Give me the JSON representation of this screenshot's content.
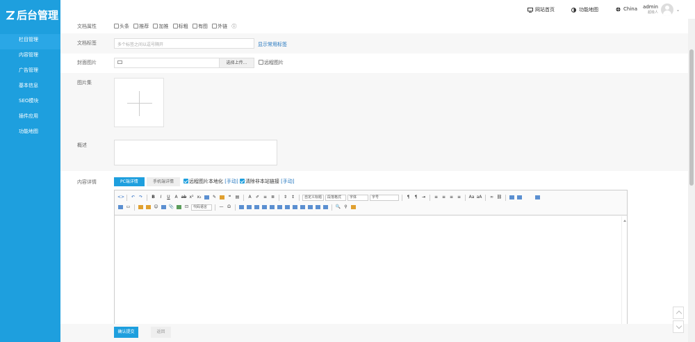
{
  "app": {
    "brand": "后台管理"
  },
  "sidebar": {
    "items": [
      {
        "label": "栏目管理"
      },
      {
        "label": "内容管理"
      },
      {
        "label": "广告管理"
      },
      {
        "label": "基本信息"
      },
      {
        "label": "SEO模块"
      },
      {
        "label": "插件应用"
      },
      {
        "label": "功能地图"
      }
    ]
  },
  "topbar": {
    "site_home": "网站首页",
    "func_map": "功能地图",
    "language": "China",
    "username": "admin",
    "role": "超级人"
  },
  "form": {
    "attr_label": "文档属性",
    "attrs": [
      "头条",
      "推荐",
      "加推",
      "标粗",
      "有图",
      "外链"
    ],
    "tags_label": "文档标签",
    "tags_placeholder": "多个标签之间以逗号隔开",
    "tags_link": "显示常用标签",
    "cover_label": "封面图片",
    "upload_btn": "选择上传...",
    "remote_image": "远程图片",
    "gallery_label": "图片集",
    "summary_label": "概述",
    "content_label": "内容详情",
    "tab_pc": "PC端详情",
    "tab_mobile": "手机端详情",
    "opt_localize": "远程图片本地化",
    "opt_localize_manual": "[手动]",
    "opt_strip_links": "清除非本站链接",
    "opt_strip_manual": "[手动]"
  },
  "editor": {
    "custom_title": "自定义标题",
    "paragraph": "段落格式",
    "font": "字体",
    "font_size": "字号",
    "code_lang": "代码语言"
  },
  "actions": {
    "submit": "确认提交",
    "back": "返回"
  },
  "colors": {
    "accent": "#1e9fde",
    "link": "#1e73be"
  }
}
